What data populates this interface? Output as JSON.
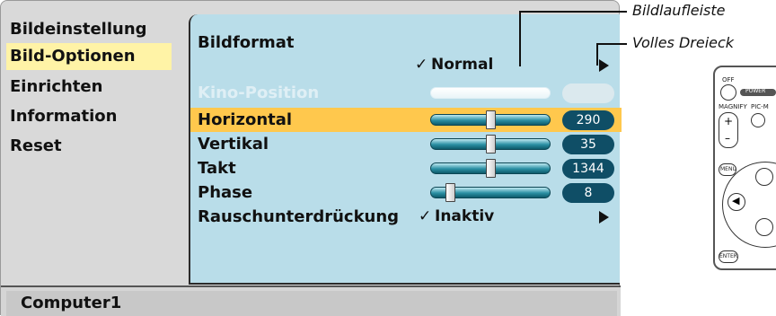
{
  "left_menu": {
    "items": [
      {
        "label": "Bildeinstellung",
        "selected": false
      },
      {
        "label": "Bild-Optionen",
        "selected": true
      },
      {
        "label": "Einrichten",
        "selected": false
      },
      {
        "label": "Information",
        "selected": false
      },
      {
        "label": "Reset",
        "selected": false
      }
    ]
  },
  "content": {
    "bildformat": {
      "label": "Bildformat",
      "value": "Normal",
      "check": "✓"
    },
    "kino_position": {
      "label": "Kino-Position",
      "disabled": true
    },
    "horizontal": {
      "label": "Horizontal",
      "value": "290",
      "level": 0.5
    },
    "vertikal": {
      "label": "Vertikal",
      "value": "35",
      "level": 0.5
    },
    "takt": {
      "label": "Takt",
      "value": "1344",
      "level": 0.5
    },
    "phase": {
      "label": "Phase",
      "value": "8",
      "level": 0.13
    },
    "rauschunterdrueckung": {
      "label": "Rauschunterdrückung",
      "value": "Inaktiv",
      "check": "✓"
    }
  },
  "status": {
    "source": "Computer1"
  },
  "annotations": {
    "scrollbar": "Bildlaufleiste",
    "full_triangle": "Volles Dreieck"
  },
  "remote": {
    "labels": {
      "off": "OFF",
      "power": "POWER",
      "magnify": "MAGNIFY",
      "picmute": "PIC-M",
      "menu": "MENU",
      "enter": "ENTER"
    }
  },
  "colors": {
    "panel": "#d9d9d9",
    "content_bg": "#b9dde9",
    "highlight": "#ffc84d",
    "selected_left": "#fff3a6",
    "pill": "#0f4e66"
  },
  "icons": {
    "arrow": "right-triangle-icon",
    "check": "checkmark-icon"
  }
}
